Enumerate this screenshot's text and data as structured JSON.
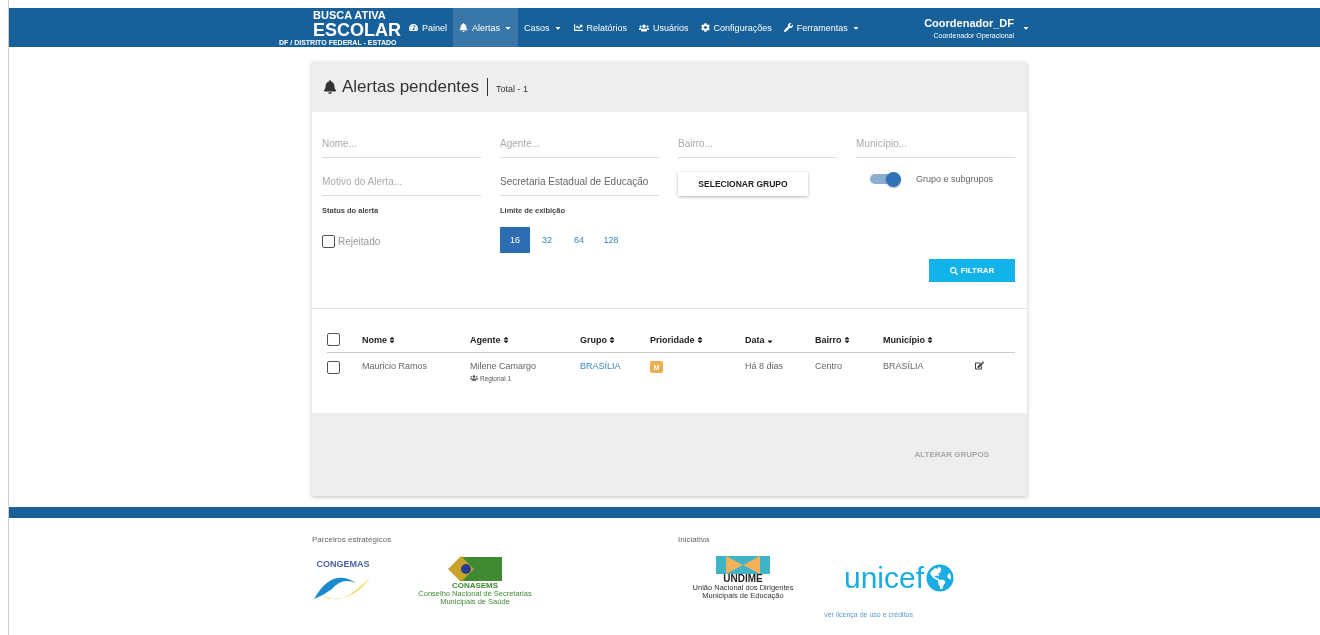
{
  "nav": {
    "brand": {
      "line1": "BUSCA ATIVA",
      "line2": "ESCOLAR",
      "subtitle": "DF / DISTRITO FEDERAL - ESTADO"
    },
    "items": [
      {
        "label": "Painel",
        "dropdown": false,
        "selected": false
      },
      {
        "label": "Alertas",
        "dropdown": true,
        "selected": true
      },
      {
        "label": "Casos",
        "dropdown": true,
        "selected": false
      },
      {
        "label": "Relatórios",
        "dropdown": false,
        "selected": false
      },
      {
        "label": "Usuários",
        "dropdown": false,
        "selected": false
      },
      {
        "label": "Configurações",
        "dropdown": false,
        "selected": false
      },
      {
        "label": "Ferramentas",
        "dropdown": true,
        "selected": false
      }
    ],
    "user": {
      "name": "Coordenador_DF",
      "role": "Coordenador Operacional"
    }
  },
  "panel": {
    "title": "Alertas pendentes",
    "total": "Total - 1",
    "fields": [
      {
        "placeholder": "Nome..."
      },
      {
        "placeholder": "Agente..."
      },
      {
        "placeholder": "Bairro..."
      },
      {
        "placeholder": "Município..."
      },
      {
        "placeholder": "Motivo do Alerta..."
      },
      {
        "value": "Secretaria Estadual de Educação"
      }
    ],
    "select_group_button": "SELECIONAR GRUPO",
    "toggle": {
      "label": "Grupo e subgrupos",
      "on": true
    },
    "status": {
      "label": "Status do alerta",
      "options": [
        {
          "label": "Rejeitado",
          "checked": false
        }
      ]
    },
    "limit": {
      "label": "Limite de exibição",
      "options": [
        {
          "label": "16",
          "selected": true
        },
        {
          "label": "32",
          "selected": false
        },
        {
          "label": "64",
          "selected": false
        },
        {
          "label": "128",
          "selected": false
        }
      ]
    },
    "filter_button": "FILTRAR",
    "table": {
      "all_checked": false,
      "columns": [
        {
          "label": "Nome",
          "sorted": false
        },
        {
          "label": "Agente",
          "sorted": false
        },
        {
          "label": "Grupo",
          "sorted": false
        },
        {
          "label": "Prioridade",
          "sorted": false
        },
        {
          "label": "Data",
          "sorted": true
        },
        {
          "label": "Bairro",
          "sorted": false
        },
        {
          "label": "Município",
          "sorted": false
        }
      ],
      "rows": [
        {
          "checked": false,
          "nome": "Mauricio Ramos",
          "agente": "Milene Camargo",
          "agente_group": "Regional 1",
          "grupo": "BRASÍLIA",
          "prioridade": "M",
          "data": "Há 8 dias",
          "bairro": "Centro",
          "municipio": "BRASÍLIA"
        }
      ]
    },
    "alter_button": {
      "label": "ALTERAR GRUPOS",
      "disabled": true
    }
  },
  "footer": {
    "partners_label": "Parceiros estratégicos",
    "partners": [
      {
        "kind": "congemas",
        "name": "CONGEMAS"
      },
      {
        "kind": "conasems",
        "name": "CONASEMS",
        "caption": "Conselho Nacional de Secretarias Municipais de Saúde"
      }
    ],
    "initiative_label": "Iniciativa",
    "initiative": [
      {
        "kind": "undime",
        "name": "UNDIME",
        "caption": "União Nacional dos Dirigentes Municipais de Educação"
      },
      {
        "kind": "unicef",
        "name": "unicef"
      }
    ],
    "license_link": "ver licença de uso e créditos"
  }
}
